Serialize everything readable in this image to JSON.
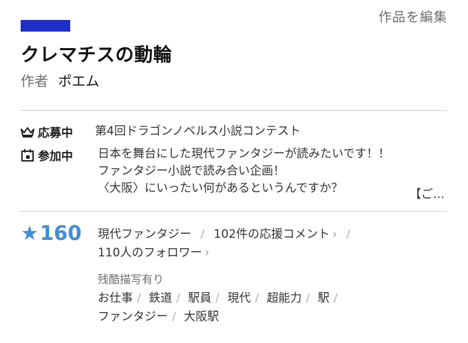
{
  "header": {
    "edit_label": "作品を編集",
    "accent_color": "#1e2fc8"
  },
  "work": {
    "title": "クレマチスの動輪",
    "author_label": "作者",
    "author_name": "ポエム"
  },
  "contest": {
    "badge_label": "応募中",
    "badge_icon": "crown-icon",
    "text": "第4回ドラゴンノベルス小説コンテスト"
  },
  "participation": {
    "badge_label": "参加中",
    "badge_icon": "calendar-icon",
    "lines": [
      "日本を舞台にした現代ファンタジーが読みたいです！！",
      "ファンタジー小説で読み合い企画！",
      "〈大阪〉にいったい何があるというんですか？"
    ],
    "more": "【ご…"
  },
  "stats": {
    "star_count": "160",
    "star_color": "#3f8ed8",
    "genre": "現代ファンタジー",
    "comments": "102件の応援コメント",
    "followers": "110人のフォロワー"
  },
  "tags": {
    "label": "残酷描写有り",
    "row1": [
      "お仕事",
      "鉄道",
      "駅員",
      "現代",
      "超能力",
      "駅"
    ],
    "row2": [
      "ファンタジー",
      "大阪駅"
    ]
  }
}
